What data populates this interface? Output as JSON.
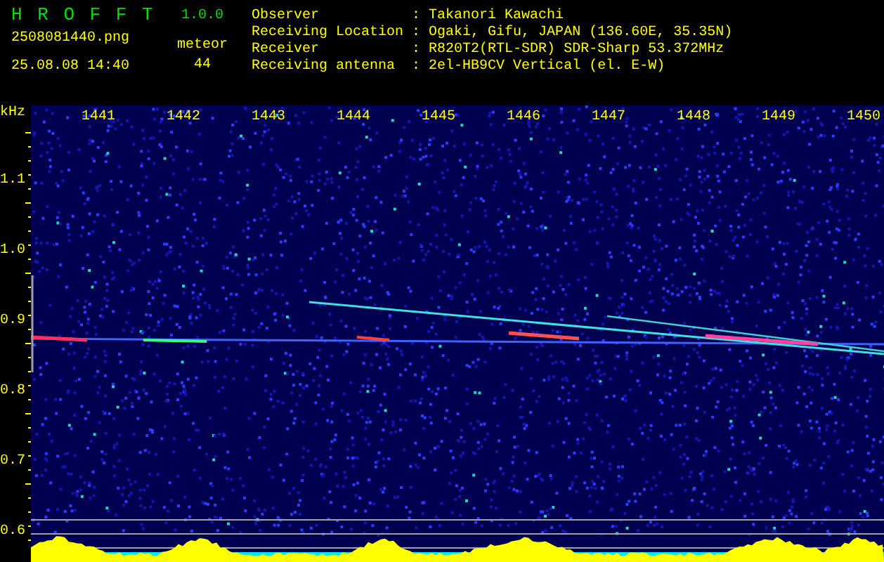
{
  "app": {
    "name": "H R O F F T",
    "version": "1.0.0",
    "filename": "2508081440.png",
    "timestamp": "25.08.08 14:40",
    "count_label": "meteor",
    "count": "44"
  },
  "station": [
    {
      "label": "Observer",
      "separator": ":",
      "value": "Takanori Kawachi"
    },
    {
      "label": "Receiving Location",
      "separator": ":",
      "value": "Ogaki, Gifu, JAPAN (136.60E, 35.35N)"
    },
    {
      "label": "Receiver",
      "separator": ":",
      "value": "R820T2(RTL-SDR) SDR-Sharp 53.372MHz"
    },
    {
      "label": "Receiving antenna",
      "separator": ":",
      "value": "2el-HB9CV Vertical (el. E-W)"
    }
  ],
  "spectrogram": {
    "unit": "kHz",
    "time_labels": [
      "1441",
      "1442",
      "1443",
      "1444",
      "1445",
      "1446",
      "1447",
      "1448",
      "1449",
      "1450"
    ],
    "frequency_labels": [
      "1.1",
      "1.0",
      "0.9",
      "0.8",
      "0.7",
      "0.6"
    ]
  }
}
